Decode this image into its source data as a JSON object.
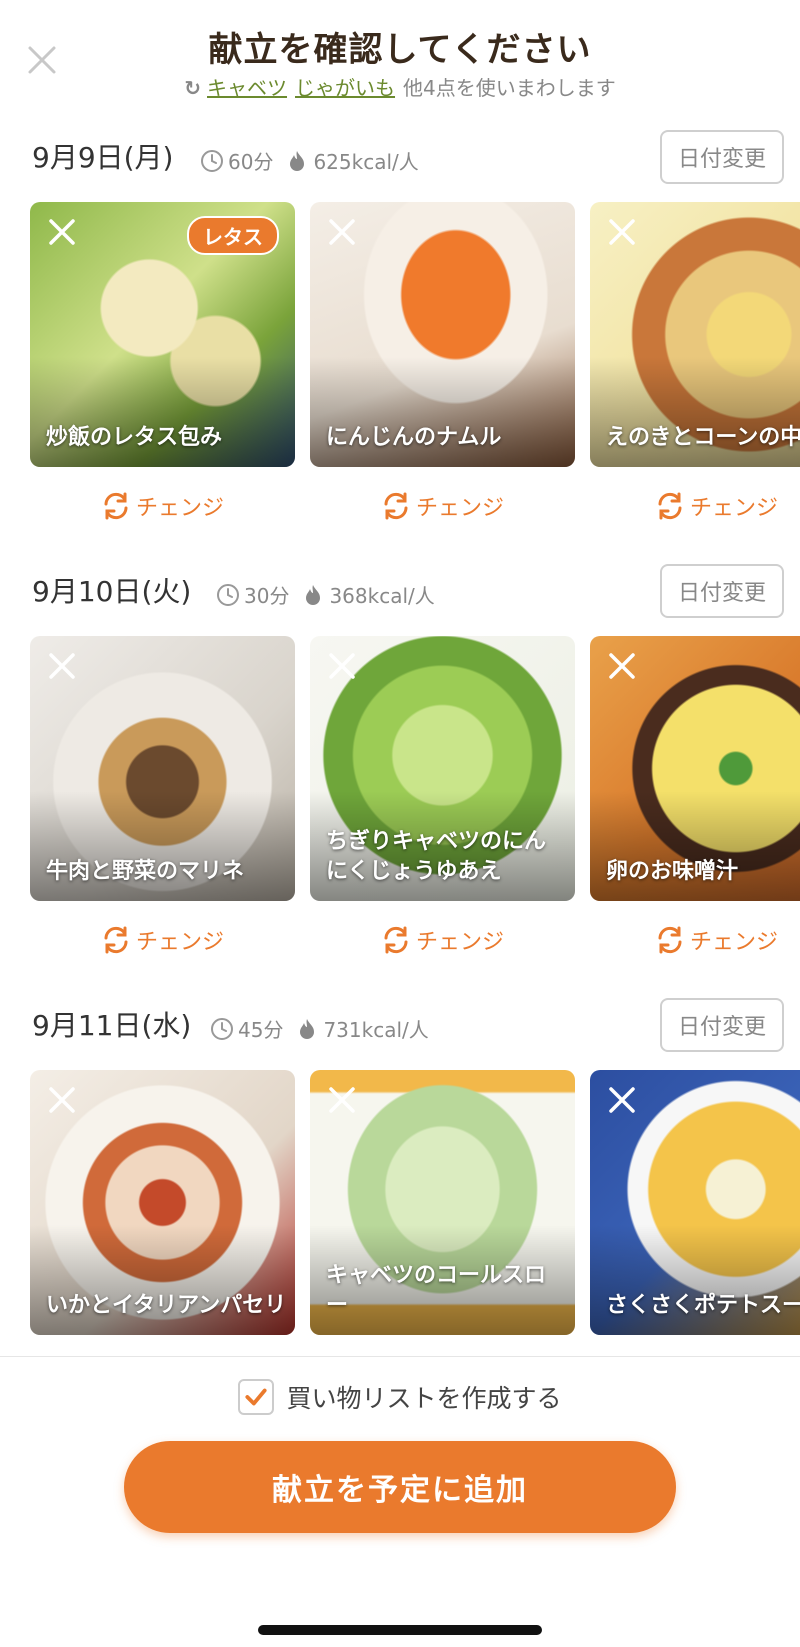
{
  "header": {
    "title": "献立を確認してください",
    "subtitle": {
      "ingredients": [
        "キャベツ",
        "じゃがいも"
      ],
      "rest": "他4点を使いまわします"
    }
  },
  "days": [
    {
      "date": "9月9日(月)",
      "time": "60分",
      "calories": "625kcal/人",
      "date_button": "日付変更",
      "dishes": [
        {
          "name": "炒飯のレタス包み",
          "badge": "レタス",
          "change": "チェンジ"
        },
        {
          "name": "にんじんのナムル",
          "change": "チェンジ"
        },
        {
          "name": "えのきとコーンの中華スープ",
          "change": "チェンジ"
        }
      ]
    },
    {
      "date": "9月10日(火)",
      "time": "30分",
      "calories": "368kcal/人",
      "date_button": "日付変更",
      "dishes": [
        {
          "name": "牛肉と野菜のマリネ",
          "change": "チェンジ"
        },
        {
          "name": "ちぎりキャベツのにんにくじょうゆあえ",
          "change": "チェンジ"
        },
        {
          "name": "卵のお味噌汁",
          "change": "チェンジ"
        }
      ]
    },
    {
      "date": "9月11日(水)",
      "time": "45分",
      "calories": "731kcal/人",
      "date_button": "日付変更",
      "dishes": [
        {
          "name": "いかとイタリアンパセリ"
        },
        {
          "name": "キャベツのコールスロー"
        },
        {
          "name": "さくさくポテトスープ"
        }
      ]
    }
  ],
  "footer": {
    "shopping_list_label": "買い物リストを作成する",
    "shopping_list_checked": true,
    "add_button": "献立を予定に追加"
  },
  "colors": {
    "accent": "#ea7a2d",
    "ingredient_link": "#6b8a2e",
    "title": "#3a2a1c"
  }
}
